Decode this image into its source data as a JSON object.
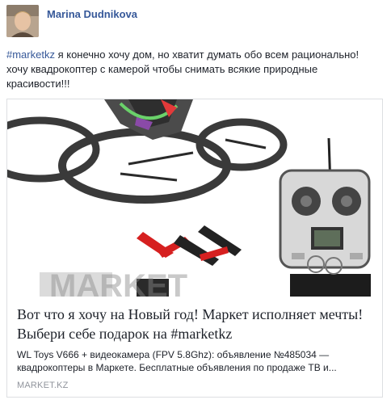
{
  "author": {
    "name": "Marina Dudnikova"
  },
  "post": {
    "hashtag": "#marketkz",
    "text": " я конечно хочу дом, но хватит думать обо всем рационально! хочу квадрокоптер с камерой чтобы снимать всякие природные красивости!!!"
  },
  "link_card": {
    "watermark": "MARKET",
    "title": "Вот что я хочу на Новый год! Маркет исполняет мечты! Выбери себе подарок на #marketkz",
    "description": "WL Toys V666 + видеокамера (FPV 5.8Ghz): объявление №485034 — квадрокоптеры в Маркете. Бесплатные объявления по продаже ТВ и...",
    "domain": "MARKET.KZ"
  },
  "colors": {
    "link": "#365899",
    "text": "#1d2129",
    "muted": "#90949c",
    "border": "#dddfe2"
  }
}
